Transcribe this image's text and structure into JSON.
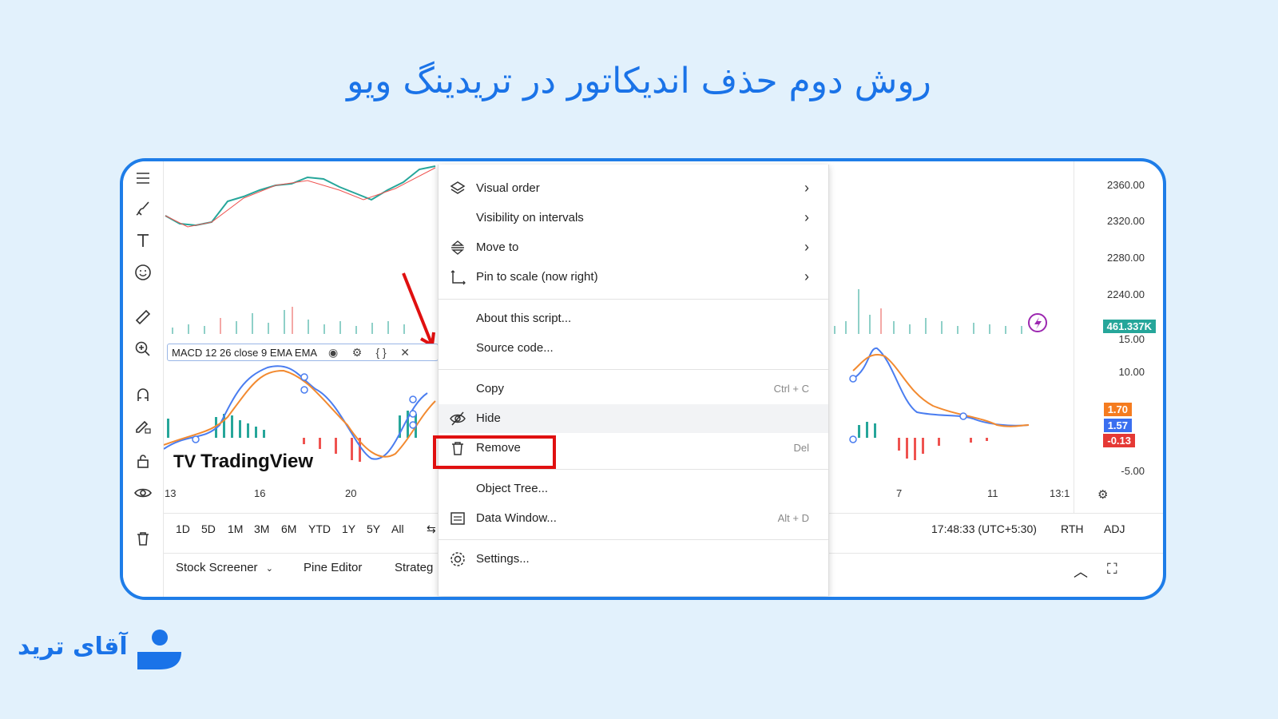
{
  "headline": "روش دوم حذف اندیکاتور در تریدینگ ویو",
  "brand": {
    "name": "آقای ترید"
  },
  "colors": {
    "accent": "#1a73e8",
    "frame": "#1e7de8",
    "highlight_box": "#e01010",
    "bull": "#26a69a",
    "bear": "#ef5350"
  },
  "toolbar": {
    "icons": [
      "menu-lines-icon",
      "brush-icon",
      "text-icon",
      "emoji-icon",
      "ruler-icon",
      "zoom-in-icon",
      "magnet-icon",
      "pencil-lock-icon",
      "lock-icon",
      "eye-icon",
      "trash-icon"
    ]
  },
  "price_scale": {
    "labels": [
      "2360.00",
      "2320.00",
      "2280.00",
      "2240.00",
      "15.00",
      "10.00",
      "-5.00"
    ],
    "volume_badge": "461.337K",
    "macd_badges": [
      "1.70",
      "1.57",
      "-0.13"
    ]
  },
  "macd_legend": {
    "label": "MACD 12 26 close 9 EMA EMA"
  },
  "logo": "TradingView",
  "time_axis": {
    "labels": [
      "13",
      "16",
      "20",
      "7",
      "11",
      "13:1"
    ]
  },
  "ranges": [
    "1D",
    "5D",
    "1M",
    "3M",
    "6M",
    "YTD",
    "1Y",
    "5Y",
    "All"
  ],
  "status": {
    "time": "17:48:33 (UTC+5:30)",
    "session": "RTH",
    "adj": "ADJ"
  },
  "footer": {
    "items": [
      "Stock Screener",
      "Pine Editor",
      "Strateg"
    ]
  },
  "context_menu": {
    "visual_order": "Visual order",
    "visibility": "Visibility on intervals",
    "move_to": "Move to",
    "pin_scale": "Pin to scale (now right)",
    "about": "About this script...",
    "source": "Source code...",
    "copy": "Copy",
    "copy_shortcut": "Ctrl + C",
    "hide": "Hide",
    "remove": "Remove",
    "remove_shortcut": "Del",
    "object_tree": "Object Tree...",
    "data_window": "Data Window...",
    "data_window_shortcut": "Alt + D",
    "settings": "Settings..."
  }
}
